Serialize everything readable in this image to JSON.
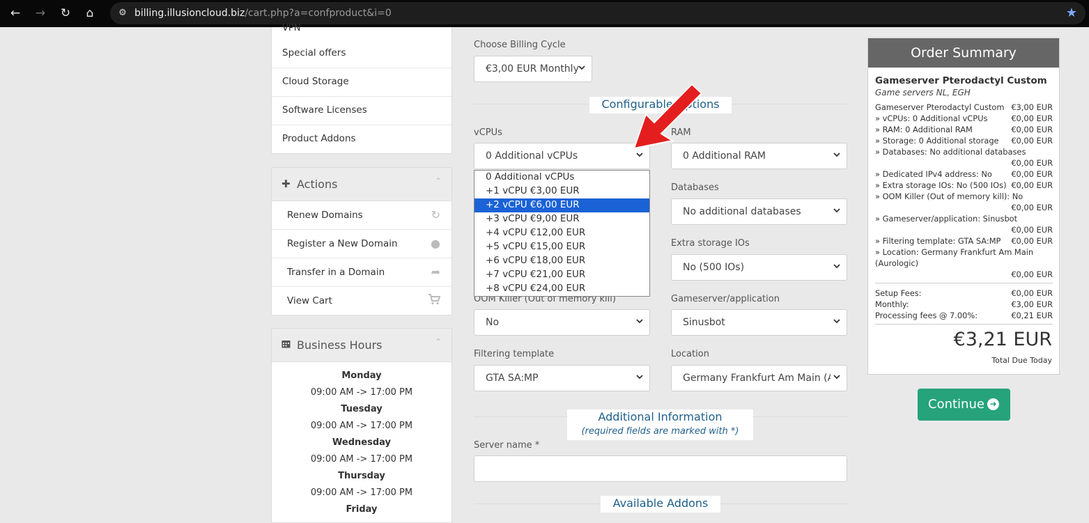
{
  "browser": {
    "url_host": "billing.illusioncloud.biz",
    "url_path": "/cart.php?a=confproduct&i=0"
  },
  "sidebar": {
    "categories": {
      "cut_item": "VPN",
      "items": [
        "Special offers",
        "Cloud Storage",
        "Software Licenses",
        "Product Addons"
      ]
    },
    "actions": {
      "title": "Actions",
      "items": [
        "Renew Domains",
        "Register a New Domain",
        "Transfer in a Domain",
        "View Cart"
      ]
    },
    "hours": {
      "title": "Business Hours",
      "days": [
        {
          "day": "Monday",
          "time": "09:00 AM -> 17:00 PM"
        },
        {
          "day": "Tuesday",
          "time": "09:00 AM -> 17:00 PM"
        },
        {
          "day": "Wednesday",
          "time": "09:00 AM -> 17:00 PM"
        },
        {
          "day": "Thursday",
          "time": "09:00 AM -> 17:00 PM"
        },
        {
          "day": "Friday",
          "time": ""
        }
      ]
    }
  },
  "form": {
    "billing_cycle": {
      "label": "Choose Billing Cycle",
      "value": "€3,00 EUR Monthly"
    },
    "configurable_title": "Configurable Options",
    "vcpus": {
      "label": "vCPUs",
      "value": "0 Additional vCPUs"
    },
    "ram": {
      "label": "RAM",
      "value": "0 Additional RAM"
    },
    "databases": {
      "label": "Databases",
      "value": "No additional databases"
    },
    "extra_storage": {
      "label": "Extra storage IOs",
      "value": "No (500 IOs)"
    },
    "oom": {
      "label": "OOM Killer (Out of memory kill)",
      "value": "No"
    },
    "gameserver": {
      "label": "Gameserver/application",
      "value": "Sinusbot"
    },
    "filtering": {
      "label": "Filtering template",
      "value": "GTA SA:MP"
    },
    "location": {
      "label": "Location",
      "value": "Germany Frankfurt Am Main (Aurologic)"
    },
    "additional_title": "Additional Information",
    "additional_sub": "(required fields are marked with *)",
    "server_name": {
      "label": "Server name *",
      "value": ""
    },
    "addons_title": "Available Addons"
  },
  "dropdown": {
    "options": [
      "0 Additional vCPUs",
      "+1 vCPU €3,00 EUR",
      "+2 vCPU €6,00 EUR",
      "+3 vCPU €9,00 EUR",
      "+4 vCPU €12,00 EUR",
      "+5 vCPU €15,00 EUR",
      "+6 vCPU €18,00 EUR",
      "+7 vCPU €21,00 EUR",
      "+8 vCPU €24,00 EUR"
    ],
    "highlighted": "+2 vCPU €6,00 EUR"
  },
  "summary": {
    "title": "Order Summary",
    "product": "Gameserver Pterodactyl Custom",
    "group": "Game servers NL, EGH",
    "lines": [
      {
        "l": "Gameserver Pterodactyl Custom",
        "r": "€3,00 EUR"
      },
      {
        "l": " » vCPUs: 0 Additional vCPUs",
        "r": "€0,00 EUR"
      },
      {
        "l": " » RAM: 0 Additional RAM",
        "r": "€0,00 EUR"
      },
      {
        "l": " » Storage: 0 Additional storage",
        "r": "€0,00 EUR"
      },
      {
        "l": " » Databases: No additional databases",
        "r": ""
      },
      {
        "l": "",
        "r": "€0,00 EUR"
      },
      {
        "l": " » Dedicated IPv4 address: No",
        "r": "€0,00 EUR"
      },
      {
        "l": " » Extra storage IOs: No (500 IOs)",
        "r": "€0,00 EUR"
      },
      {
        "l": " » OOM Killer (Out of memory kill): No",
        "r": ""
      },
      {
        "l": "",
        "r": "€0,00 EUR"
      },
      {
        "l": " » Gameserver/application: Sinusbot",
        "r": ""
      },
      {
        "l": "",
        "r": "€0,00 EUR"
      },
      {
        "l": " » Filtering template: GTA SA:MP",
        "r": "€0,00 EUR"
      },
      {
        "l": " » Location: Germany Frankfurt Am Main",
        "r": ""
      },
      {
        "l": "(Aurologic)",
        "r": ""
      },
      {
        "l": "",
        "r": "€0,00 EUR"
      }
    ],
    "fees": [
      {
        "l": "Setup Fees:",
        "r": "€0,00 EUR"
      },
      {
        "l": "Monthly:",
        "r": "€3,00 EUR"
      },
      {
        "l": "Processing fees @ 7.00%:",
        "r": "€0,21 EUR"
      }
    ],
    "total": "€3,21 EUR",
    "total_caption": "Total Due Today",
    "continue_label": "Continue"
  }
}
